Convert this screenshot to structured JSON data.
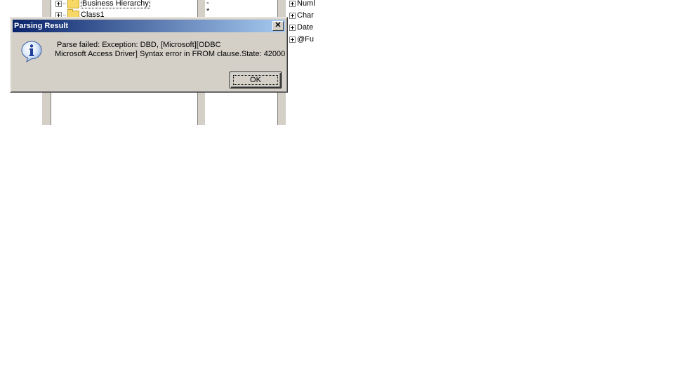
{
  "background": {
    "tree_items": [
      "Business Hierarchy",
      "Class1"
    ],
    "middle_column": [
      "-",
      "*"
    ],
    "right_tree_items": [
      "Numl",
      "Char",
      "Date",
      "@Fu"
    ]
  },
  "dialog": {
    "title": "Parsing Result",
    "close_label": "✕",
    "message_line1": "Parse failed: Exception: DBD, [Microsoft][ODBC",
    "message_line2": "Microsoft Access Driver] Syntax error in FROM clause.State: 42000",
    "ok_label": "OK",
    "icon": "info-icon"
  },
  "colors": {
    "title_gradient_start": "#0a246a",
    "title_gradient_end": "#a6caf0",
    "dialog_face": "#d4d0c8"
  }
}
